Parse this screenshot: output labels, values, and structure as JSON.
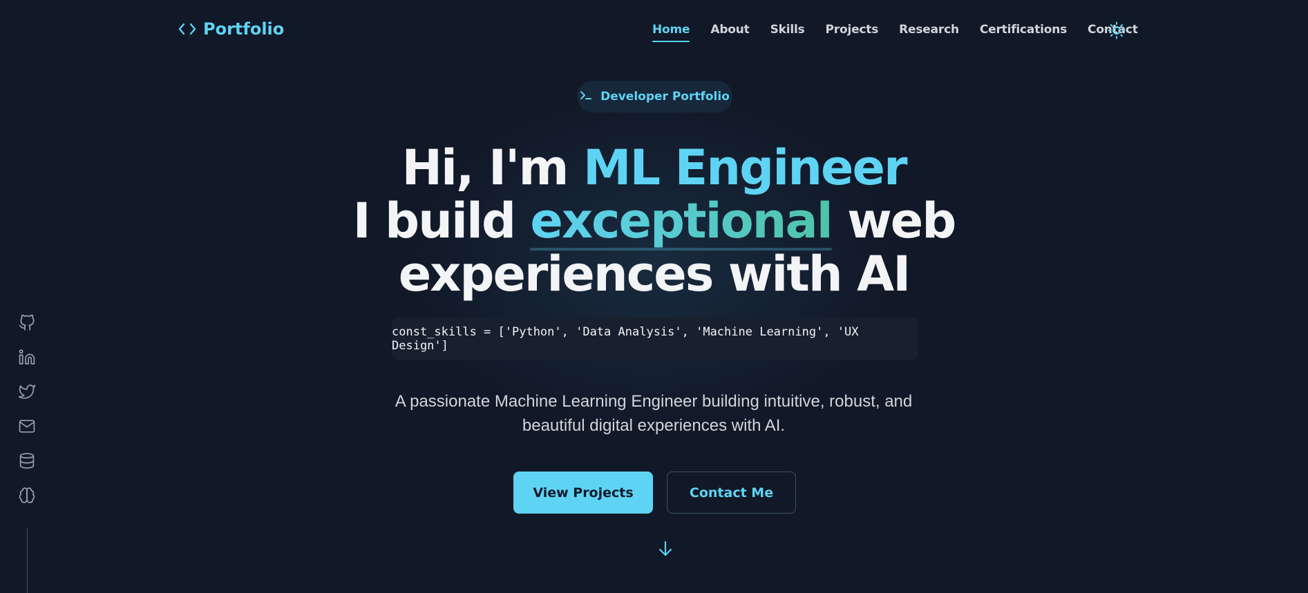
{
  "brand": {
    "logo_text": "Portfolio",
    "logo_icon": "code-brackets-icon"
  },
  "nav": {
    "items": [
      {
        "label": "Home",
        "active": true
      },
      {
        "label": "About"
      },
      {
        "label": "Skills"
      },
      {
        "label": "Projects"
      },
      {
        "label": "Research"
      },
      {
        "label": "Certifications"
      },
      {
        "label": "Contact"
      }
    ],
    "theme_toggle_icon": "sun-icon"
  },
  "hero": {
    "badge": {
      "icon": "terminal-icon",
      "label": "Developer Portfolio"
    },
    "greeting_prefix": "Hi, I'm",
    "role": "ML Engineer",
    "line2_prefix": "I build",
    "highlight_word": "exceptional",
    "line2_suffix": "web",
    "line3": "experiences with AI",
    "code_snippet": "const_skills = ['Python', 'Data Analysis', 'Machine Learning', 'UX Design']",
    "description": "A passionate Machine Learning Engineer building intuitive, robust, and beautiful digital experiences with AI.",
    "primary_button": "View Projects",
    "secondary_button": "Contact Me",
    "scroll_icon": "arrow-down-icon"
  },
  "social": [
    "github-icon",
    "linkedin-icon",
    "twitter-icon",
    "mail-icon",
    "database-icon",
    "brain-icon"
  ],
  "colors": {
    "background": "#111827",
    "accent": "#5fd3f3",
    "accent_green": "#4fc3a8",
    "text": "#f3f4f6",
    "muted": "#d1d5db"
  }
}
